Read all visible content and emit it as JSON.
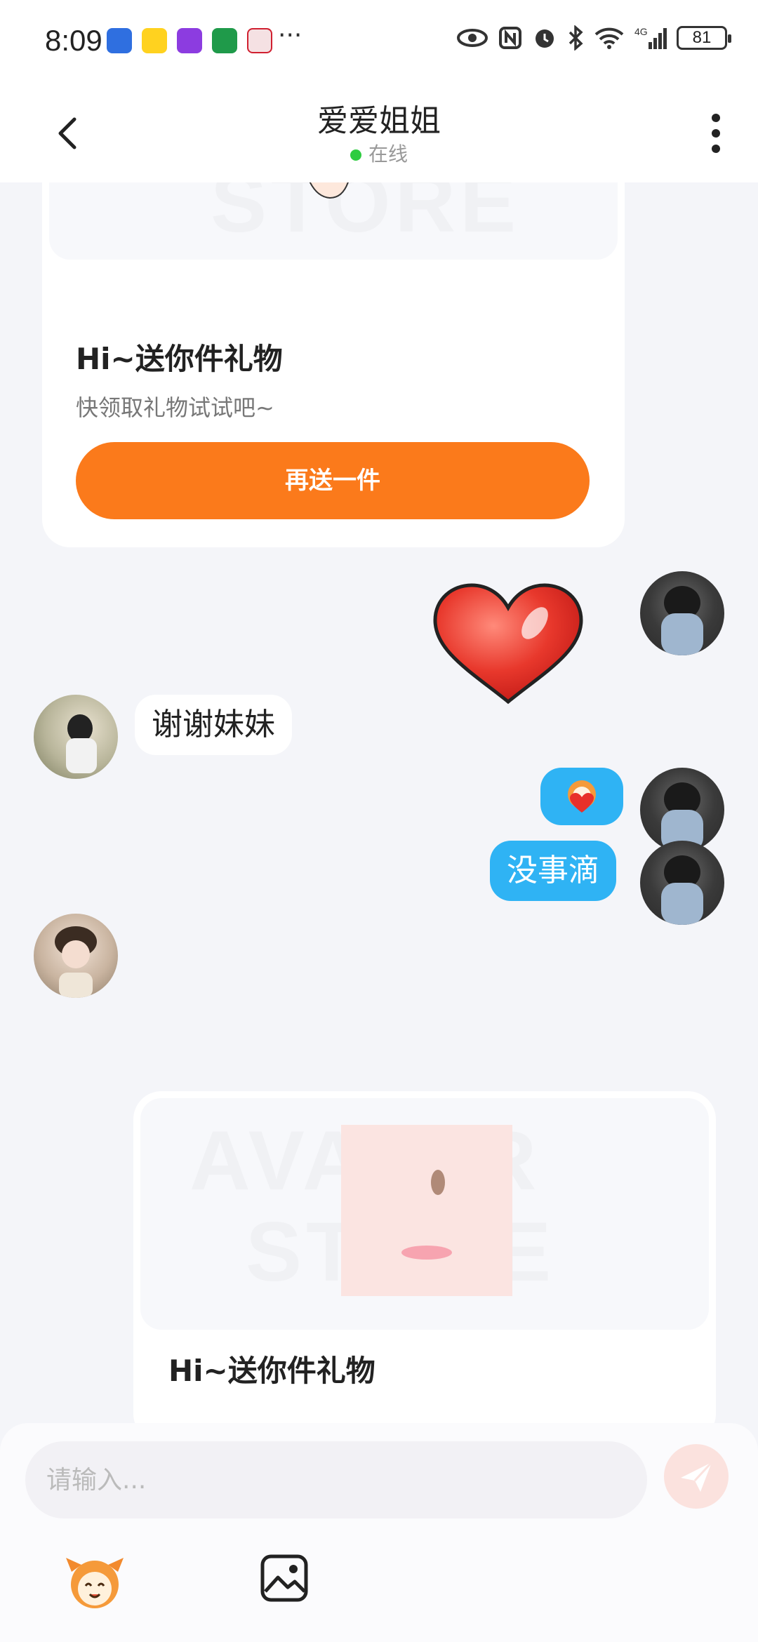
{
  "status_bar": {
    "time": "8:09",
    "more": "···",
    "battery": "81",
    "network": "4G"
  },
  "header": {
    "title": "爱爱姐姐",
    "status": "在线"
  },
  "messages": {
    "gift_card_1": {
      "ghost_text": "STORE",
      "title": "Hi~送你件礼物",
      "subtitle": "快领取礼物试试吧~",
      "button": "再送一件"
    },
    "heart_sticker": "heart-sticker",
    "reply_1": "谢谢妹妹",
    "reply_2": "没事滴",
    "gift_card_2": {
      "ghost_text_1": "AVATAR",
      "ghost_text_2": "STORE",
      "title": "Hi~送你件礼物"
    }
  },
  "input": {
    "placeholder": "请输入..."
  },
  "colors": {
    "accent_orange": "#fb7a1b",
    "bubble_blue": "#2fb3f4",
    "online_green": "#2ecc40"
  }
}
